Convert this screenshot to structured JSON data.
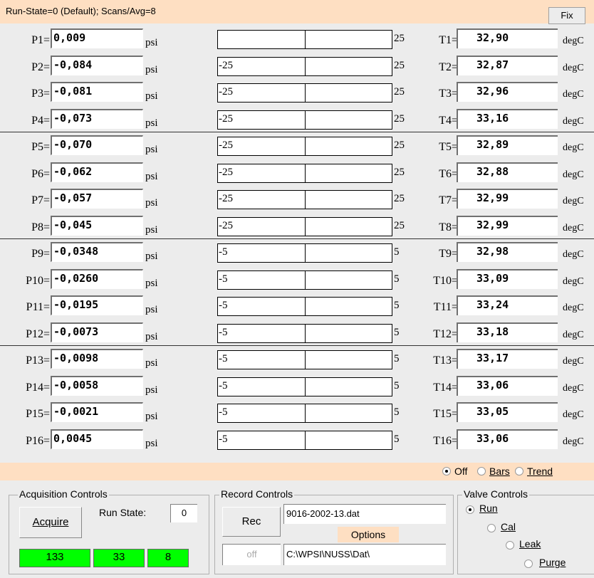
{
  "header": {
    "text": "Run-State=0 (Default); Scans/Avg=8",
    "fix_label": "Fix"
  },
  "pressure_unit": "psi",
  "temp_unit": "degC",
  "rows": [
    {
      "p_label": "P1=",
      "p_value": " 0,009",
      "bar_min": "",
      "bar_max": "25",
      "t_label": "T1=",
      "t_value": "32,90"
    },
    {
      "p_label": "P2=",
      "p_value": "-0,084",
      "bar_min": "-25",
      "bar_max": "25",
      "t_label": "T2=",
      "t_value": "32,87"
    },
    {
      "p_label": "P3=",
      "p_value": "-0,081",
      "bar_min": "-25",
      "bar_max": "25",
      "t_label": "T3=",
      "t_value": "32,96"
    },
    {
      "p_label": "P4=",
      "p_value": "-0,073",
      "bar_min": "-25",
      "bar_max": "25",
      "t_label": "T4=",
      "t_value": "33,16"
    },
    {
      "p_label": "P5=",
      "p_value": "-0,070",
      "bar_min": "-25",
      "bar_max": "25",
      "t_label": "T5=",
      "t_value": "32,89"
    },
    {
      "p_label": "P6=",
      "p_value": "-0,062",
      "bar_min": "-25",
      "bar_max": "25",
      "t_label": "T6=",
      "t_value": "32,88"
    },
    {
      "p_label": "P7=",
      "p_value": "-0,057",
      "bar_min": "-25",
      "bar_max": "25",
      "t_label": "T7=",
      "t_value": "32,99"
    },
    {
      "p_label": "P8=",
      "p_value": "-0,045",
      "bar_min": "-25",
      "bar_max": "25",
      "t_label": "T8=",
      "t_value": "32,99"
    },
    {
      "p_label": "P9=",
      "p_value": "-0,0348",
      "bar_min": "-5",
      "bar_max": "5",
      "t_label": "T9=",
      "t_value": "32,98"
    },
    {
      "p_label": "P10=",
      "p_value": "-0,0260",
      "bar_min": "-5",
      "bar_max": "5",
      "t_label": "T10=",
      "t_value": "33,09"
    },
    {
      "p_label": "P11=",
      "p_value": "-0,0195",
      "bar_min": "-5",
      "bar_max": "5",
      "t_label": "T11=",
      "t_value": "33,24"
    },
    {
      "p_label": "P12=",
      "p_value": "-0,0073",
      "bar_min": "-5",
      "bar_max": "5",
      "t_label": "T12=",
      "t_value": "33,18"
    },
    {
      "p_label": "P13=",
      "p_value": "-0,0098",
      "bar_min": "-5",
      "bar_max": "5",
      "t_label": "T13=",
      "t_value": "33,17"
    },
    {
      "p_label": "P14=",
      "p_value": "-0,0058",
      "bar_min": "-5",
      "bar_max": "5",
      "t_label": "T14=",
      "t_value": "33,06"
    },
    {
      "p_label": "P15=",
      "p_value": "-0,0021",
      "bar_min": "-5",
      "bar_max": "5",
      "t_label": "T15=",
      "t_value": "33,05"
    },
    {
      "p_label": "P16=",
      "p_value": " 0,0045",
      "bar_min": "-5",
      "bar_max": "5",
      "t_label": "T16=",
      "t_value": "33,06"
    }
  ],
  "display_mode": {
    "selected": "Off",
    "options": [
      "Off",
      "Bars",
      "Trend"
    ]
  },
  "acquisition": {
    "title": "Acquisition Controls",
    "acquire_label": "Acquire",
    "run_state_label": "Run State:",
    "run_state_value": "0",
    "counters": [
      "133",
      "33",
      "8"
    ]
  },
  "record": {
    "title": "Record Controls",
    "rec_label": "Rec",
    "filename": "9016-2002-13.dat",
    "options_label": "Options",
    "status": "off",
    "path": "C:\\WPSI\\NUSS\\Dat\\"
  },
  "valve": {
    "title": "Valve Controls",
    "selected": "Run",
    "options": [
      "Run",
      "Cal",
      "Leak",
      "Purge"
    ]
  }
}
